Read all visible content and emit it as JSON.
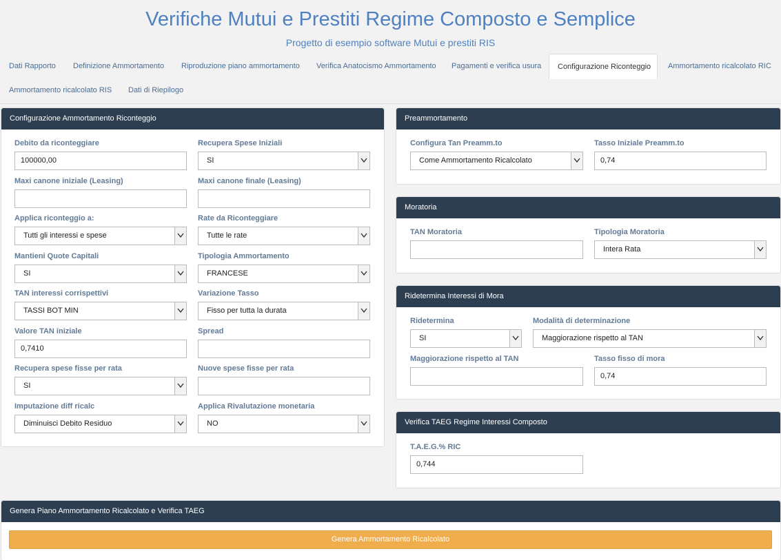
{
  "header": {
    "title": "Verifiche Mutui e Prestiti Regime Composto e Semplice",
    "subtitle": "Progetto di esempio software Mutui e prestiti RIS"
  },
  "tabs": [
    "Dati Rapporto",
    "Definizione Ammortamento",
    "Riproduzione piano ammortamento",
    "Verifica Anatocismo Ammortamento",
    "Pagamenti e verifica usura",
    "Configurazione Riconteggio",
    "Ammortamento ricalcolato RIC",
    "Ammortamento ricalcolato RIS",
    "Dati di Riepilogo"
  ],
  "config": {
    "title": "Configurazione Ammortamento Riconteggio",
    "debito_label": "Debito da riconteggiare",
    "debito_value": "100000,00",
    "recupera_spese_label": "Recupera Spese Iniziali",
    "recupera_spese_value": "SI",
    "maxi_iniziale_label": "Maxi canone iniziale (Leasing)",
    "maxi_iniziale_value": "",
    "maxi_finale_label": "Maxi canone finale (Leasing)",
    "maxi_finale_value": "",
    "applica_label": "Applica riconteggio a:",
    "applica_value": "Tutti gli interessi e spese",
    "rate_label": "Rate da Riconteggiare",
    "rate_value": "Tutte le rate",
    "mantieni_label": "Mantieni Quote Capitali",
    "mantieni_value": "SI",
    "tipologia_label": "Tipologia Ammortamento",
    "tipologia_value": "FRANCESE",
    "tan_corr_label": "TAN interessi corrispettivi",
    "tan_corr_value": "TASSI BOT MIN",
    "variazione_label": "Variazione Tasso",
    "variazione_value": "Fisso per tutta la durata",
    "valore_tan_label": "Valore TAN iniziale",
    "valore_tan_value": "0,7410",
    "spread_label": "Spread",
    "spread_value": "",
    "spese_fisse_label": "Recupera spese fisse per rata",
    "spese_fisse_value": "SI",
    "nuove_spese_label": "Nuove spese fisse per rata",
    "nuove_spese_value": "",
    "imputazione_label": "Imputazione diff ricalc",
    "imputazione_value": "Diminuisci Debito Residuo",
    "rivalutazione_label": "Applica Rivalutazione monetaria",
    "rivalutazione_value": "NO"
  },
  "preamm": {
    "title": "Preammortamento",
    "tan_label": "Configura Tan Preamm.to",
    "tan_value": "Come Ammortamento Ricalcolato",
    "tasso_label": "Tasso Iniziale Preamm.to",
    "tasso_value": "0,74"
  },
  "moratoria": {
    "title": "Moratoria",
    "tan_label": "TAN Moratoria",
    "tan_value": "",
    "tipologia_label": "Tipologia Moratoria",
    "tipologia_value": "Intera Rata"
  },
  "mora": {
    "title": "Ridetermina Interessi di Mora",
    "ridetermina_label": "Ridetermina",
    "ridetermina_value": "SI",
    "modalita_label": "Modalità di determinazione",
    "modalita_value": "Maggiorazione rispetto al TAN",
    "maggiorazione_label": "Maggiorazione rispetto al TAN",
    "maggiorazione_value": "",
    "tasso_label": "Tasso fisso di mora",
    "tasso_value": "0,74"
  },
  "taeg": {
    "title": "Verifica TAEG Regime Interessi Composto",
    "label": "T.A.E.G.% RIC",
    "value": "0,744"
  },
  "genera": {
    "title": "Genera Piano Ammortamento Ricalcolato e Verifica TAEG",
    "button_label": "Genera Ammortamento Ricalcolato"
  },
  "icons": {
    "select_arrow": "chevron-down-icon"
  },
  "colors": {
    "header_blue": "#4f81c0",
    "panel_head": "#2c3e50",
    "button_orange": "#f0ad4e"
  }
}
